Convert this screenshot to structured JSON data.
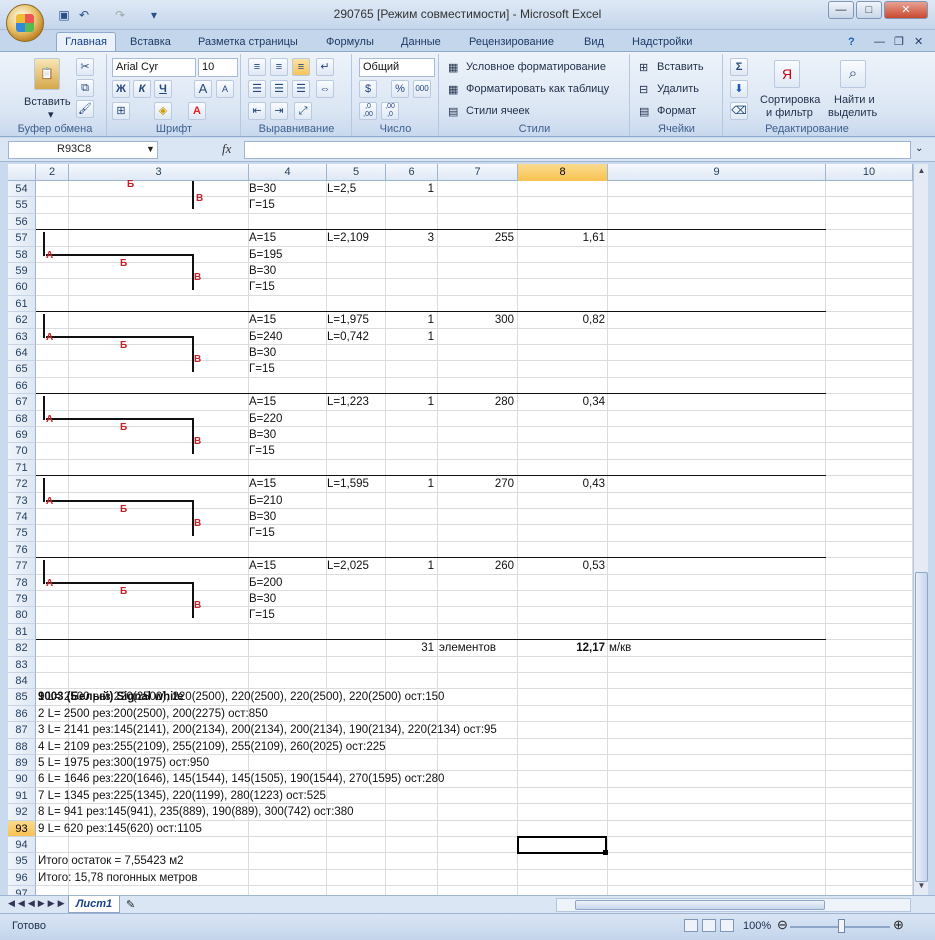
{
  "window": {
    "title": "290765  [Режим совместимости] - Microsoft Excel",
    "minimize": "—",
    "maximize": "□",
    "close": "✕",
    "doc_min": "—",
    "doc_restore": "❐",
    "doc_close": "✕",
    "help": "?"
  },
  "tabs": [
    "Главная",
    "Вставка",
    "Разметка страницы",
    "Формулы",
    "Данные",
    "Рецензирование",
    "Вид",
    "Надстройки"
  ],
  "ribbon": {
    "clipboard": {
      "paste": "Вставить",
      "label": "Буфер обмена"
    },
    "font": {
      "name": "Arial Cyr",
      "size": "10",
      "bold": "Ж",
      "italic": "К",
      "underline": "Ч",
      "grow": "A",
      "shrink": "A",
      "label": "Шрифт"
    },
    "alignment": {
      "label": "Выравнивание"
    },
    "number": {
      "format": "Общий",
      "percent": "%",
      "thousands": "000",
      "inc_dec": ",0\n,00",
      "dec_dec": ",00\n,0",
      "label": "Число"
    },
    "styles": {
      "conditional": "Условное форматирование",
      "as_table": "Форматировать как таблицу",
      "cell_styles": "Стили ячеек",
      "label": "Стили"
    },
    "cells": {
      "insert": "Вставить",
      "delete": "Удалить",
      "format": "Формат",
      "label": "Ячейки"
    },
    "editing": {
      "sort": "Сортировка",
      "sort2": "и фильтр",
      "find": "Найти и",
      "find2": "выделить",
      "label": "Редактирование"
    }
  },
  "formula_bar": {
    "name_box": "R93C8",
    "fx": "fx",
    "value": ""
  },
  "columns": [
    "2",
    "3",
    "4",
    "5",
    "6",
    "7",
    "8",
    "9",
    "10"
  ],
  "selected_column": "8",
  "rows": [
    "54",
    "55",
    "56",
    "57",
    "58",
    "59",
    "60",
    "61",
    "62",
    "63",
    "64",
    "65",
    "66",
    "67",
    "68",
    "69",
    "70",
    "71",
    "72",
    "73",
    "74",
    "75",
    "76",
    "77",
    "78",
    "79",
    "80",
    "81",
    "82",
    "83",
    "84",
    "85",
    "86",
    "87",
    "88",
    "89",
    "90",
    "91",
    "92",
    "93",
    "94",
    "95",
    "96",
    "97"
  ],
  "selected_row": "93",
  "row54": {
    "c4": "В=30",
    "c5": "L=2,5",
    "c6": "1"
  },
  "row55": {
    "c4": "Г=15"
  },
  "blocks": [
    {
      "a": "А=15",
      "b": "Б=195",
      "v": "В=30",
      "g": "Г=15",
      "L": "L=2,109",
      "qty": "3",
      "len": "255",
      "area": "1,61",
      "L2": "",
      "qty2": ""
    },
    {
      "a": "А=15",
      "b": "Б=240",
      "v": "В=30",
      "g": "Г=15",
      "L": "L=1,975",
      "qty": "1",
      "len": "300",
      "area": "0,82",
      "L2": "L=0,742",
      "qty2": "1"
    },
    {
      "a": "А=15",
      "b": "Б=220",
      "v": "В=30",
      "g": "Г=15",
      "L": "L=1,223",
      "qty": "1",
      "len": "280",
      "area": "0,34",
      "L2": "",
      "qty2": ""
    },
    {
      "a": "А=15",
      "b": "Б=210",
      "v": "В=30",
      "g": "Г=15",
      "L": "L=1,595",
      "qty": "1",
      "len": "270",
      "area": "0,43",
      "L2": "",
      "qty2": ""
    },
    {
      "a": "А=15",
      "b": "Б=200",
      "v": "В=30",
      "g": "Г=15",
      "L": "L=2,025",
      "qty": "1",
      "len": "260",
      "area": "0,53",
      "L2": "",
      "qty2": ""
    }
  ],
  "shape_labels": {
    "a": "А",
    "b": "Б",
    "v": "В"
  },
  "summary": {
    "count": "31",
    "count_label": "элементов",
    "total": "12,17",
    "unit": "м/кв"
  },
  "cutting": {
    "title": "9003 (Белый) Signal white",
    "lines": [
      "1 L= 2500 рез:220(2500), 220(2500), 220(2500), 220(2500), 220(2500) ост:150",
      "2 L= 2500 рез:200(2500), 200(2275) ост:850",
      "3 L= 2141 рез:145(2141), 200(2134), 200(2134), 200(2134), 190(2134), 220(2134) ост:95",
      "4 L= 2109 рез:255(2109), 255(2109), 255(2109), 260(2025) ост:225",
      "5 L= 1975 рез:300(1975) ост:950",
      "6 L= 1646 рез:220(1646), 145(1544), 145(1505), 190(1544), 270(1595) ост:280",
      "7 L= 1345 рез:225(1345), 220(1199), 280(1223) ост:525",
      "8 L= 941 рез:145(941), 235(889), 190(889), 300(742) ост:380",
      "9 L= 620 рез:145(620) ост:1105"
    ],
    "remainder": "Итого остаток = 7,55423 м2",
    "total_meters": "Итого: 15,78 погонных метров"
  },
  "sheet_tab": "Лист1",
  "status": {
    "ready": "Готово",
    "zoom": "100%"
  }
}
